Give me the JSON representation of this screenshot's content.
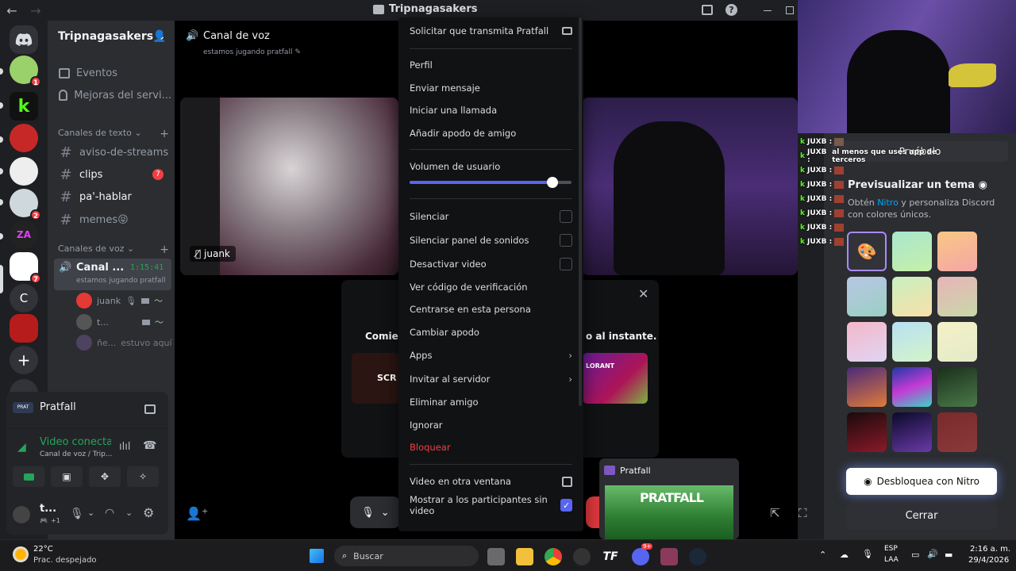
{
  "window": {
    "title": "Tripnagasakers"
  },
  "server": {
    "name": "Tripnagasakers"
  },
  "rail": {
    "badges": [
      "1",
      "2",
      "7"
    ],
    "letter_server": "C"
  },
  "sidebar": {
    "events": "Eventos",
    "boosts": "Mejoras del servi...",
    "text_category": "Canales de texto",
    "text_channels": [
      {
        "name": "aviso-de-streams",
        "badge": ""
      },
      {
        "name": "clips",
        "badge": "7"
      },
      {
        "name": "pa'-hablar",
        "badge": ""
      },
      {
        "name": "memes😝",
        "badge": ""
      }
    ],
    "voice_category": "Canales de voz",
    "voice_channel": {
      "name": "Canal ...",
      "timer": "1:15:41",
      "status": "estamos jugando pratfall"
    },
    "voice_users": [
      {
        "name": "juank",
        "status": ""
      },
      {
        "name": "t...",
        "status": ""
      },
      {
        "name": "ñe...",
        "status": "estuvo aquí"
      }
    ]
  },
  "activity_panel": {
    "game": "Pratfall",
    "connection_title": "Video conectad",
    "connection_sub": "Canal de voz / Trip..."
  },
  "user_panel": {
    "name": "t...",
    "extra": "+1"
  },
  "stage": {
    "channel_title": "Canal de voz",
    "channel_status": "estamos jugando pratfall",
    "tile_user": "juank",
    "activity_text_left": "Comienz",
    "activity_text_right": "o al instante.",
    "activity_game_left": "SCR",
    "activity_game_right": "LORANT",
    "stream_preview_title": "Pratfall"
  },
  "context_menu": {
    "request_stream": "Solicitar que transmita Pratfall",
    "profile": "Perfil",
    "send_message": "Enviar mensaje",
    "start_call": "Iniciar una llamada",
    "add_nickname": "Añadir apodo de amigo",
    "user_volume": "Volumen de usuario",
    "volume_level": 0.88,
    "mute": "Silenciar",
    "mute_soundboard": "Silenciar panel de sonidos",
    "disable_video": "Desactivar video",
    "verify_code": "Ver código de verificación",
    "focus_person": "Centrarse en esta persona",
    "change_nickname": "Cambiar apodo",
    "apps": "Apps",
    "invite_server": "Invitar al servidor",
    "remove_friend": "Eliminar amigo",
    "ignore": "Ignorar",
    "block": "Bloquear",
    "popout_video": "Video en otra ventana",
    "show_non_video": "Mostrar a los participantes sin video"
  },
  "chat_overlay": {
    "lines": [
      {
        "user": "JUXB :",
        "text": ""
      },
      {
        "user": "JUXB :",
        "text": "al menos que uses app de terceros"
      },
      {
        "user": "JUXB :",
        "text": ""
      },
      {
        "user": "JUXB :",
        "text": ""
      },
      {
        "user": "JUXB :",
        "text": ""
      },
      {
        "user": "JUXB :",
        "text": ""
      },
      {
        "user": "JUXB :",
        "text": ""
      },
      {
        "user": "JUXB :",
        "text": ""
      }
    ]
  },
  "nitro_panel": {
    "try_label": "Pruébalo",
    "title": "Previsualizar un tema",
    "desc_prefix": "Obtén ",
    "desc_link": "Nitro",
    "desc_suffix": " y personaliza Discord con colores únicos.",
    "unlock_button": "Desbloquea con Nitro",
    "close_button": "Cerrar"
  },
  "taskbar": {
    "temp": "22°C",
    "weather": "Prac. despejado",
    "search_placeholder": "Buscar",
    "lang_top": "ESP",
    "lang_bottom": "LAA",
    "time": "2:16 a. m.",
    "date": "29/4/2026",
    "discord_badge": "9+"
  },
  "colors": {
    "accent": "#5865f2",
    "green": "#23a55a",
    "red": "#f23f43",
    "nitro_text": "#00a8fc"
  }
}
